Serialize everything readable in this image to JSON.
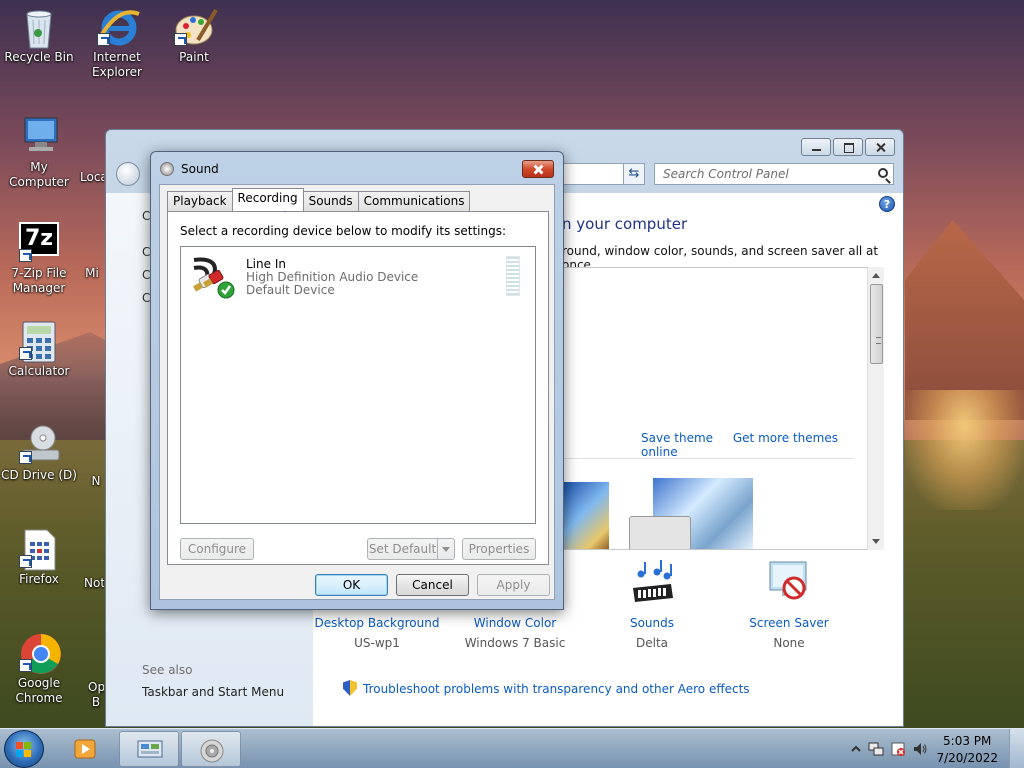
{
  "desktop": {
    "icons": [
      {
        "label": "Recycle Bin",
        "icon": "recycle-bin-icon"
      },
      {
        "label": "Internet Explorer",
        "icon": "internet-explorer-icon"
      },
      {
        "label": "Paint",
        "icon": "paint-icon"
      },
      {
        "label": "My Computer",
        "icon": "computer-icon"
      },
      {
        "label": "Loca",
        "icon": "local-disk-icon"
      },
      {
        "label": "7-Zip File Manager",
        "icon": "7zip-icon"
      },
      {
        "label": "Mi",
        "icon": "edge-icon"
      },
      {
        "label": "Calculator",
        "icon": "calculator-icon"
      },
      {
        "label": "CD Drive (D)",
        "icon": "cd-drive-icon"
      },
      {
        "label": "N",
        "icon": "app-icon"
      },
      {
        "label": "Firefox",
        "icon": "firefox-icon"
      },
      {
        "label": "Not",
        "icon": "notepad-icon"
      },
      {
        "label": "Google Chrome",
        "icon": "chrome-icon"
      },
      {
        "label": "Op",
        "icon": "opera-icon"
      },
      {
        "label": "B",
        "icon": "app-icon"
      }
    ]
  },
  "control_panel": {
    "search_placeholder": "Search Control Panel",
    "left_fragments": [
      "C",
      "C",
      "C",
      "C"
    ],
    "heading_fragment": "n your computer",
    "sub_fragment": "round, window color, sounds, and screen saver all at once.",
    "save_theme": "Save theme",
    "more_themes": "Get more themes online",
    "see_also": "See also",
    "taskbar_link": "Taskbar and Start Menu",
    "bottom_items": [
      {
        "label": "Desktop Background",
        "value": "US-wp1"
      },
      {
        "label": "Window Color",
        "value": "Windows 7 Basic"
      },
      {
        "label": "Sounds",
        "value": "Delta"
      },
      {
        "label": "Screen Saver",
        "value": "None"
      }
    ],
    "troubleshoot": "Troubleshoot problems with transparency and other Aero effects",
    "help": "?"
  },
  "sound_dialog": {
    "title": "Sound",
    "tabs": [
      "Playback",
      "Recording",
      "Sounds",
      "Communications"
    ],
    "active_tab": "Recording",
    "instruction": "Select a recording device below to modify its settings:",
    "device": {
      "name": "Line In",
      "description": "High Definition Audio Device",
      "status": "Default Device"
    },
    "buttons": {
      "configure": "Configure",
      "set_default": "Set Default",
      "properties": "Properties",
      "ok": "OK",
      "cancel": "Cancel",
      "apply": "Apply"
    }
  },
  "taskbar": {
    "time": "5:03 PM",
    "date": "7/20/2022"
  }
}
